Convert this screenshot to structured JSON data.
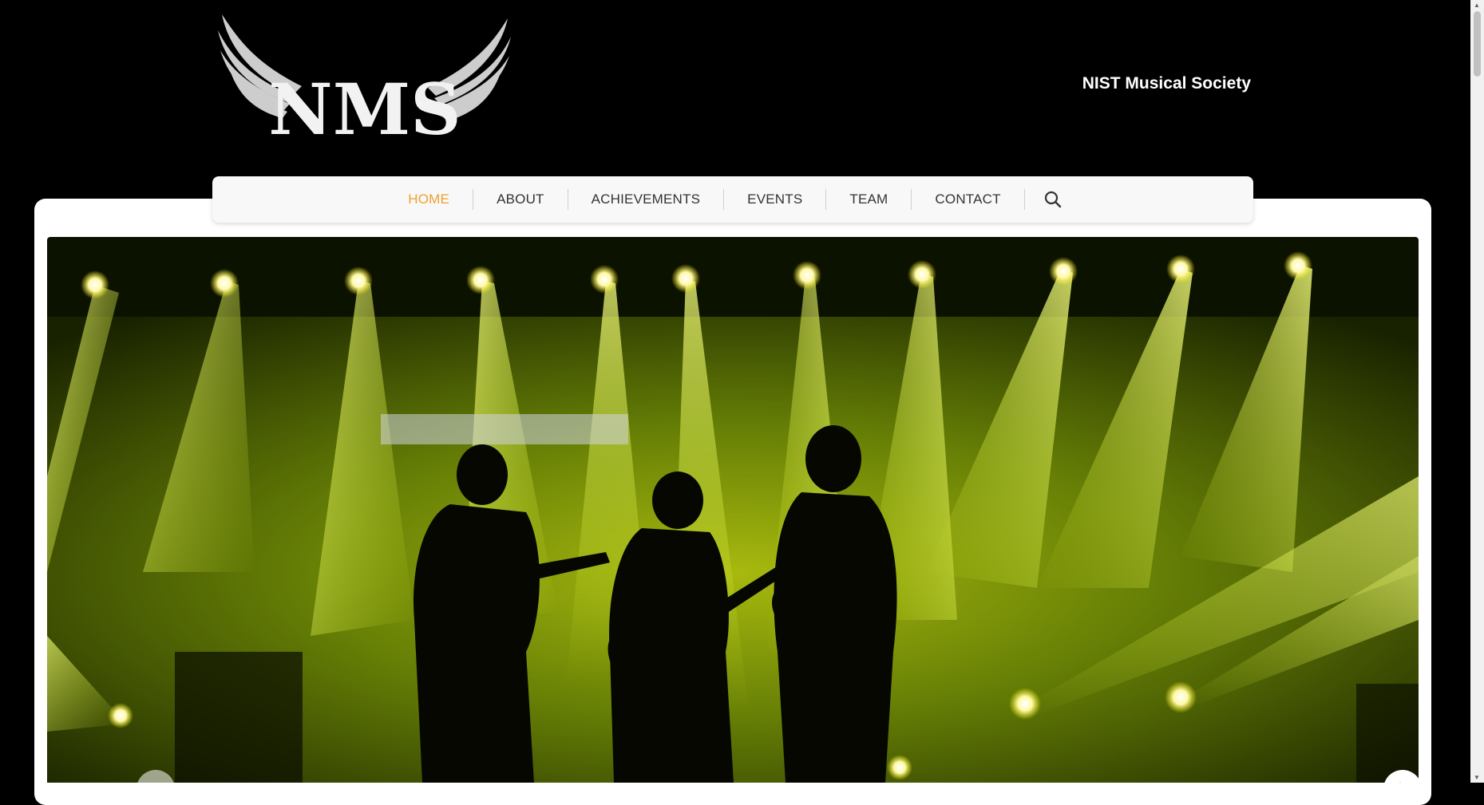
{
  "header": {
    "logo_text": "NMS",
    "site_title": "NIST Musical Society"
  },
  "nav": {
    "items": [
      {
        "label": "HOME",
        "active": true
      },
      {
        "label": "ABOUT",
        "active": false
      },
      {
        "label": "ACHIEVEMENTS",
        "active": false
      },
      {
        "label": "EVENTS",
        "active": false
      },
      {
        "label": "TEAM",
        "active": false
      },
      {
        "label": "CONTACT",
        "active": false
      }
    ],
    "search_icon": "search-icon",
    "active_color": "#f0a030"
  },
  "slider": {
    "image_subject": "band-silhouette-concert-stage",
    "prev_icon": "chevron-left-icon",
    "next_icon": "chevron-right-icon"
  },
  "colors": {
    "background": "#000000",
    "card": "#ffffff",
    "stage_light": "#e6ff3a"
  }
}
